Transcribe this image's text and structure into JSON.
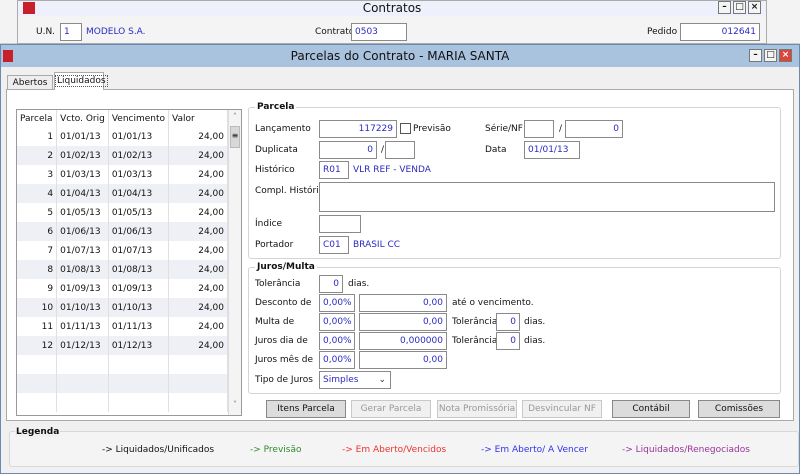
{
  "contratos": {
    "title": "Contratos",
    "un_label": "U.N.",
    "un_value": "1",
    "un_name": "MODELO S.A.",
    "contrato_label": "Contrato",
    "contrato_value": "0503",
    "pedido_label": "Pedido",
    "pedido_value": "012641"
  },
  "window": {
    "title": "Parcelas do Contrato - MARIA SANTA",
    "close_color": "#d9463a"
  },
  "tabs": [
    {
      "label": "Abertos"
    },
    {
      "label": "Liquidados",
      "active": true
    }
  ],
  "grid": {
    "headers": [
      "Parcela",
      "Vcto. Orig",
      "Vencimento",
      "Valor"
    ],
    "rows": [
      [
        "1",
        "01/01/13",
        "01/01/13",
        "24,00"
      ],
      [
        "2",
        "01/02/13",
        "01/02/13",
        "24,00"
      ],
      [
        "3",
        "01/03/13",
        "01/03/13",
        "24,00"
      ],
      [
        "4",
        "01/04/13",
        "01/04/13",
        "24,00"
      ],
      [
        "5",
        "01/05/13",
        "01/05/13",
        "24,00"
      ],
      [
        "6",
        "01/06/13",
        "01/06/13",
        "24,00"
      ],
      [
        "7",
        "01/07/13",
        "01/07/13",
        "24,00"
      ],
      [
        "8",
        "01/08/13",
        "01/08/13",
        "24,00"
      ],
      [
        "9",
        "01/09/13",
        "01/09/13",
        "24,00"
      ],
      [
        "10",
        "01/10/13",
        "01/10/13",
        "24,00"
      ],
      [
        "11",
        "01/11/13",
        "01/11/13",
        "24,00"
      ],
      [
        "12",
        "01/12/13",
        "01/12/13",
        "24,00"
      ]
    ]
  },
  "parcela": {
    "title": "Parcela",
    "lancamento_label": "Lançamento",
    "lancamento": "117229",
    "previsao_label": "Previsão",
    "serie_label": "Série/NF",
    "serie": "",
    "nf": "0",
    "duplicata_label": "Duplicata",
    "duplicata": "0",
    "duplicata2": "",
    "data_label": "Data",
    "data": "01/01/13",
    "historico_label": "Histórico",
    "historico_code": "R01",
    "historico_desc": "VLR REF - VENDA",
    "compl_label": "Compl. Histórico",
    "compl": "",
    "indice_label": "Índice",
    "indice": "",
    "portador_label": "Portador",
    "portador_code": "C01",
    "portador_desc": "BRASIL CC",
    "slash": "/"
  },
  "juros": {
    "title": "Juros/Multa",
    "tolerancia_label": "Tolerância",
    "tolerancia": "0",
    "dias": "dias.",
    "desconto_label": "Desconto de",
    "desconto_pct": "0,00%",
    "desconto_val": "0,00",
    "ate_venc": "até o vencimento.",
    "multa_label": "Multa de",
    "multa_pct": "0,00%",
    "multa_val": "0,00",
    "multa_tol": "0",
    "juros_dia_label": "Juros dia de",
    "juros_dia_pct": "0,00%",
    "juros_dia_val": "0,000000",
    "juros_dia_tol": "0",
    "juros_mes_label": "Juros mês de",
    "juros_mes_pct": "0,00%",
    "juros_mes_val": "0,00",
    "tipo_label": "Tipo de Juros",
    "tipo": "Simples"
  },
  "buttons": {
    "itens": "Itens Parcela",
    "gerar": "Gerar Parcela",
    "nota": "Nota Promissória",
    "desvincular": "Desvincular NF",
    "contabil": "Contábil",
    "comissoes": "Comissões"
  },
  "legend": {
    "title": "Legenda",
    "items": [
      {
        "label": "-> Liquidados/Unificados",
        "color": "#111111"
      },
      {
        "label": "-> Previsão",
        "color": "#2e8b2e"
      },
      {
        "label": "-> Em Aberto/Vencidos",
        "color": "#ee3333"
      },
      {
        "label": "-> Em Aberto/ A Vencer",
        "color": "#3333ee"
      },
      {
        "label": "-> Liquidados/Renegociados",
        "color": "#993399"
      }
    ]
  }
}
